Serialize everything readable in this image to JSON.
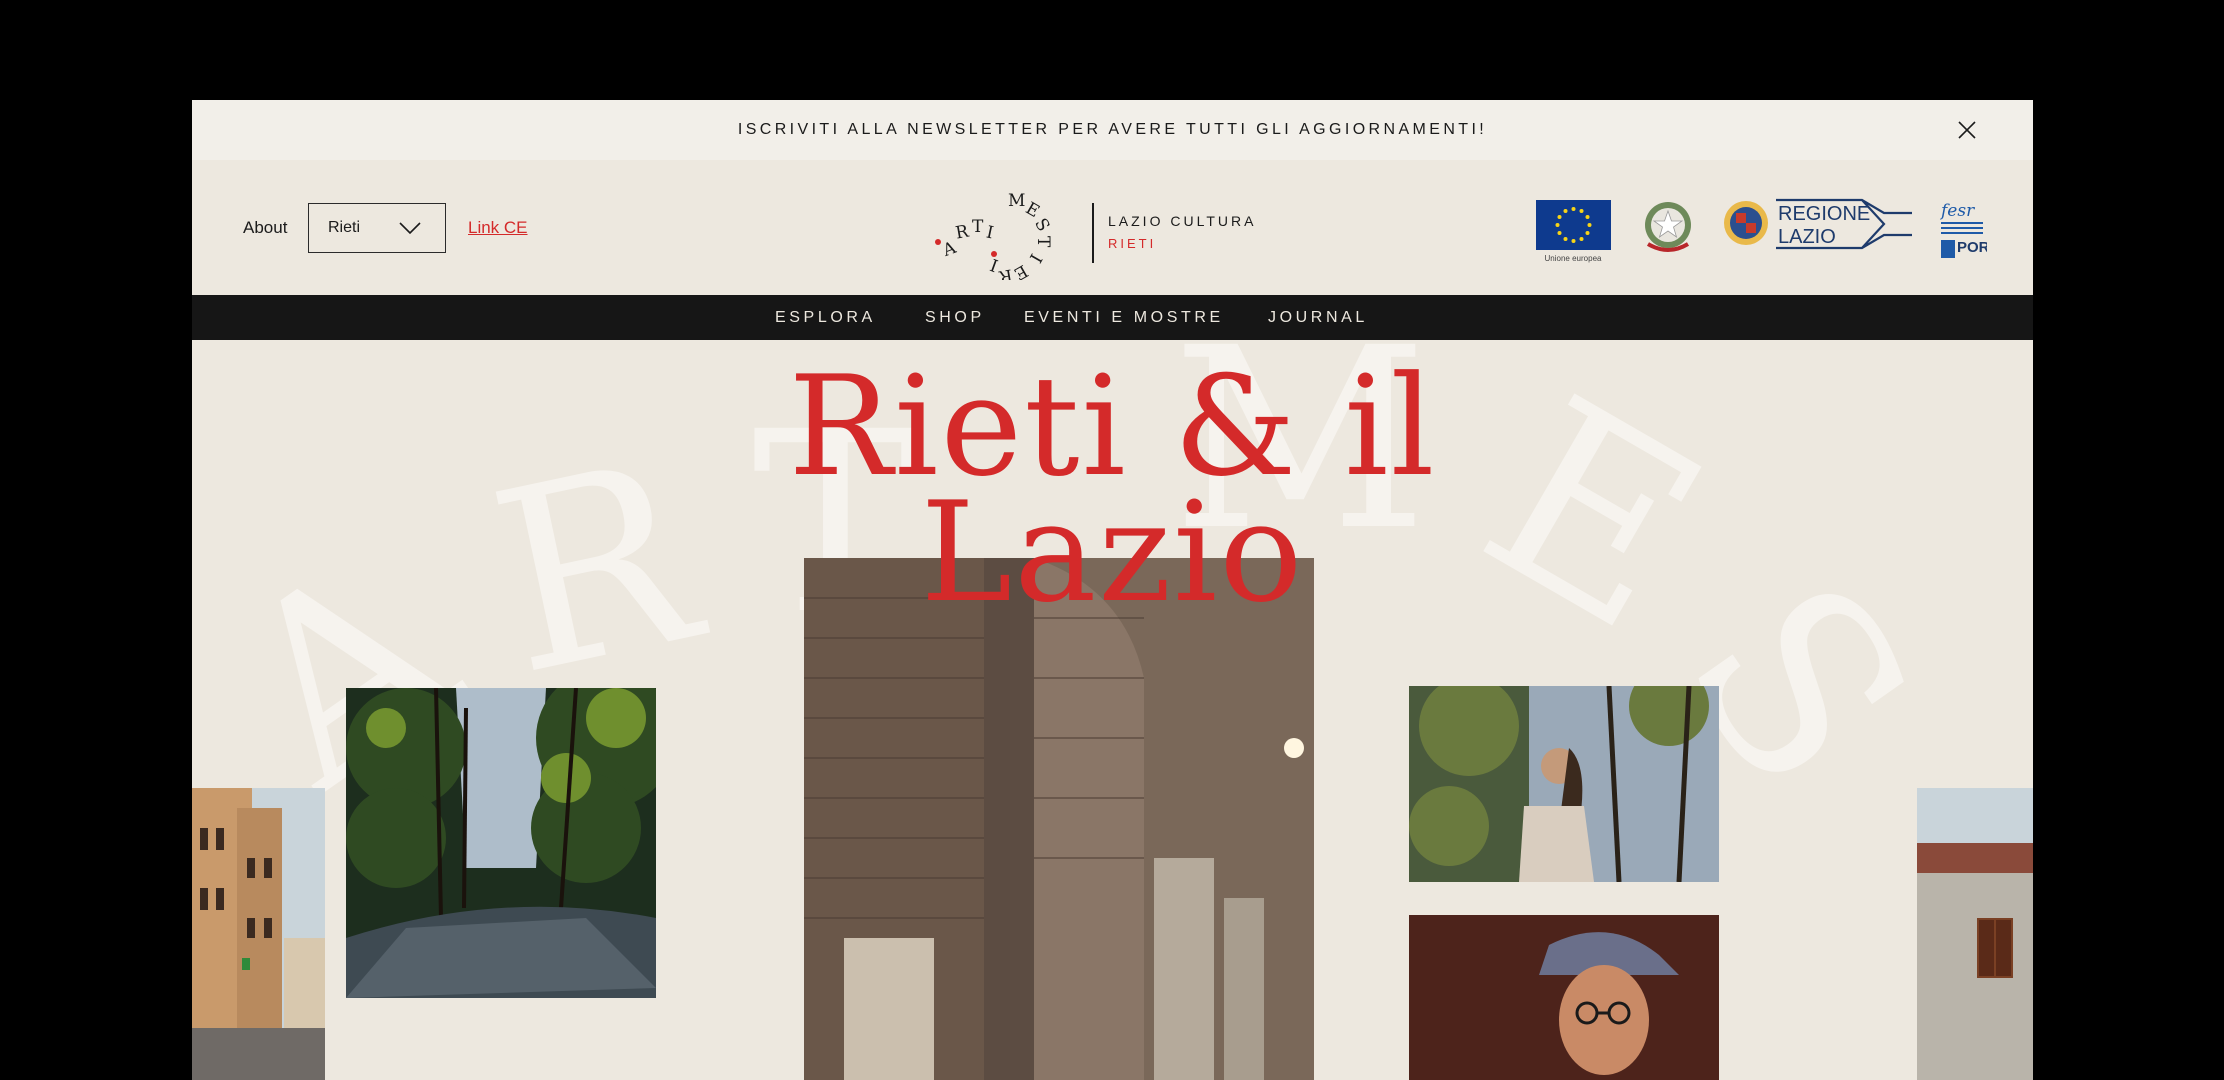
{
  "newsletter": {
    "message": "ISCRIVITI ALLA NEWSLETTER PER AVERE TUTTI GLI AGGIORNAMENTI!",
    "close_icon": "close-icon"
  },
  "header": {
    "about_label": "About",
    "city_select": {
      "value": "Rieti"
    },
    "link_ce": "Link CE",
    "logo": {
      "ring_text": "ARTI MESTIERI",
      "title": "LAZIO CULTURA",
      "subtitle": "RIETI"
    },
    "partners": {
      "eu_caption": "Unione europea",
      "region_line1": "REGIONE",
      "region_line2": "LAZIO",
      "fesr_label": "fesr",
      "fesr_por": "POR"
    }
  },
  "nav": {
    "items": [
      "ESPLORA",
      "SHOP",
      "EVENTI E MOSTRE",
      "JOURNAL"
    ]
  },
  "hero": {
    "title_line1": "Rieti & il",
    "title_line2": "Lazio",
    "background_letters": [
      "A",
      "R",
      "T",
      "M",
      "E",
      "S"
    ]
  },
  "colors": {
    "accent": "#d42a2a",
    "background": "#ede8df",
    "nav_bg": "#161616"
  }
}
